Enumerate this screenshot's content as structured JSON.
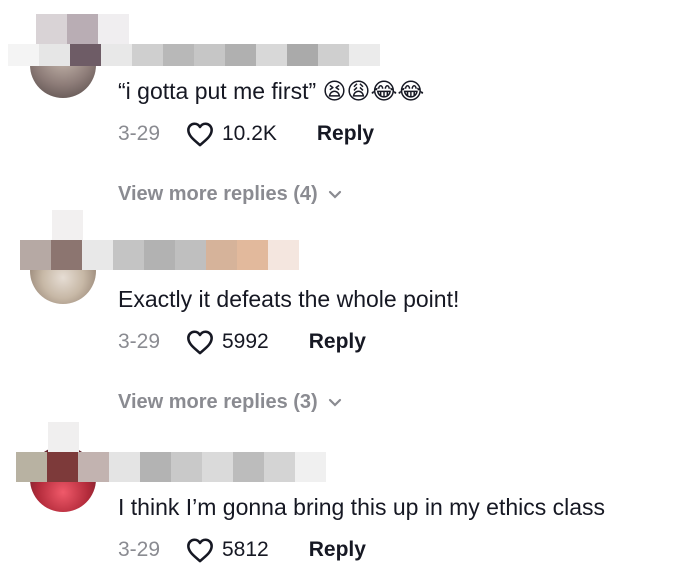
{
  "comments": [
    {
      "text": "“i gotta put me first”",
      "emojis": "😫😩😂😂",
      "date": "3-29",
      "likes": "10.2K",
      "reply_label": "Reply",
      "view_more": "View more replies (4)"
    },
    {
      "text": "Exactly it defeats the whole point!",
      "date": "3-29",
      "likes": "5992",
      "reply_label": "Reply",
      "view_more": "View more replies (3)"
    },
    {
      "text": "I think I’m gonna bring this up in my ethics class",
      "date": "3-29",
      "likes": "5812",
      "reply_label": "Reply"
    }
  ],
  "icons": {
    "like": "heart-outline-icon",
    "expand": "chevron-down-icon"
  },
  "colors": {
    "text": "#161823",
    "muted": "#8a8b91",
    "background": "#ffffff"
  }
}
